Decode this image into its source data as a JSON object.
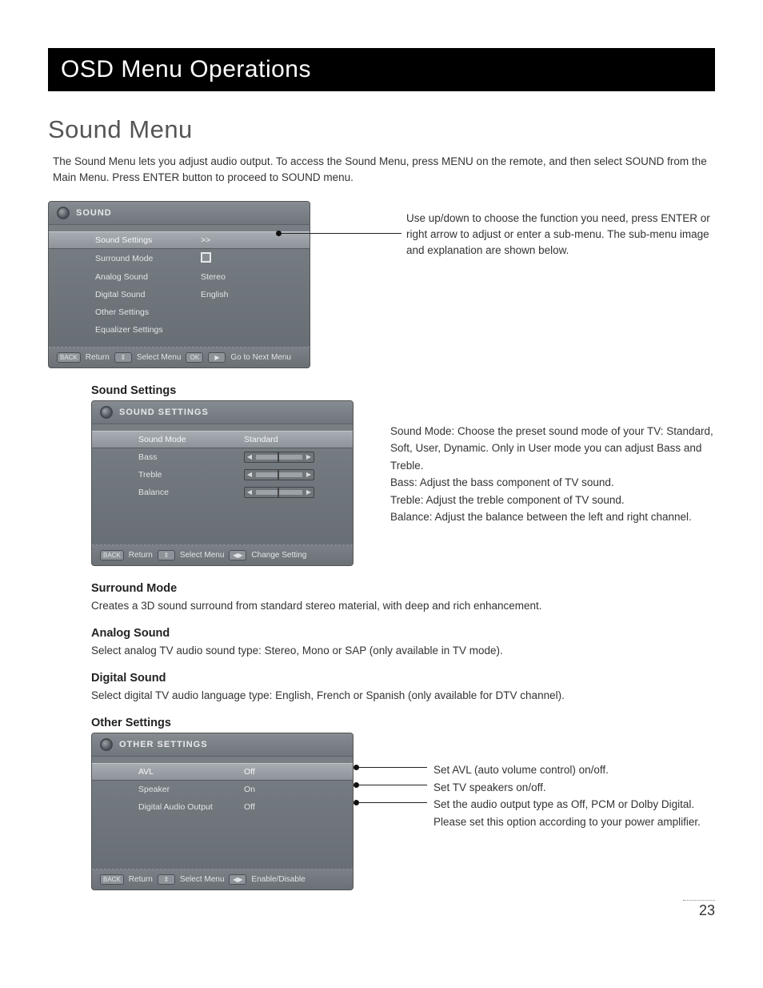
{
  "header": {
    "title": "OSD Menu Operations"
  },
  "section": {
    "title": "Sound Menu",
    "intro": "The Sound Menu lets you adjust audio output. To access the Sound Menu, press MENU on the remote, and then select SOUND from the Main Menu. Press ENTER button to proceed to SOUND menu."
  },
  "main_panel": {
    "title": "SOUND",
    "rows": [
      {
        "label": "Sound Settings",
        "value": ">>"
      },
      {
        "label": "Surround Mode",
        "value": ""
      },
      {
        "label": "Analog Sound",
        "value": "Stereo"
      },
      {
        "label": "Digital Sound",
        "value": "English"
      },
      {
        "label": "Other Settings",
        "value": ""
      },
      {
        "label": "Equalizer Settings",
        "value": ""
      }
    ],
    "footer": {
      "k1": "BACK",
      "t1": "Return",
      "k2": "⇕",
      "t2": "Select Menu",
      "k3": "OK",
      "k4": "▶",
      "t3": "Go to Next Menu"
    }
  },
  "main_callout": "Use up/down to choose the function you need, press ENTER or right arrow to adjust or enter a sub-menu. The sub-menu image and explanation are shown below.",
  "sound_settings": {
    "heading": "Sound Settings",
    "panel_title": "SOUND SETTINGS",
    "rows": [
      {
        "label": "Sound Mode",
        "value": "Standard"
      },
      {
        "label": "Bass",
        "value": ""
      },
      {
        "label": "Treble",
        "value": ""
      },
      {
        "label": "Balance",
        "value": ""
      }
    ],
    "footer": {
      "k1": "BACK",
      "t1": "Return",
      "k2": "⇕",
      "t2": "Select Menu",
      "k3": "◀▶",
      "t3": "Change Setting"
    },
    "desc_mode": "Sound Mode: Choose the preset sound mode of your TV: Standard, Soft, User, Dynamic. Only in User mode you can adjust Bass and Treble.",
    "desc_bass": "Bass: Adjust the bass component of TV sound.",
    "desc_treble": "Treble: Adjust the treble component of TV sound.",
    "desc_balance": "Balance: Adjust the balance between the left and right channel."
  },
  "surround": {
    "heading": "Surround Mode",
    "text": "Creates a 3D sound surround from standard stereo material, with deep and rich enhancement."
  },
  "analog": {
    "heading": "Analog Sound",
    "text": "Select analog TV audio sound type: Stereo, Mono or SAP (only available in TV mode)."
  },
  "digital": {
    "heading": "Digital Sound",
    "text": "Select digital TV audio language type: English, French or Spanish (only available for DTV channel)."
  },
  "other": {
    "heading": "Other Settings",
    "panel_title": "OTHER SETTINGS",
    "rows": [
      {
        "label": "AVL",
        "value": "Off"
      },
      {
        "label": "Speaker",
        "value": "On"
      },
      {
        "label": "Digital Audio Output",
        "value": "Off"
      }
    ],
    "footer": {
      "k1": "BACK",
      "t1": "Return",
      "k2": "⇕",
      "t2": "Select Menu",
      "k3": "◀▶",
      "t3": "Enable/Disable"
    },
    "c1": "Set AVL (auto volume control) on/off.",
    "c2": "Set TV speakers on/off.",
    "c3": "Set the audio output type as Off, PCM or Dolby Digital. Please set this option according to your power amplifier."
  },
  "page_number": "23"
}
